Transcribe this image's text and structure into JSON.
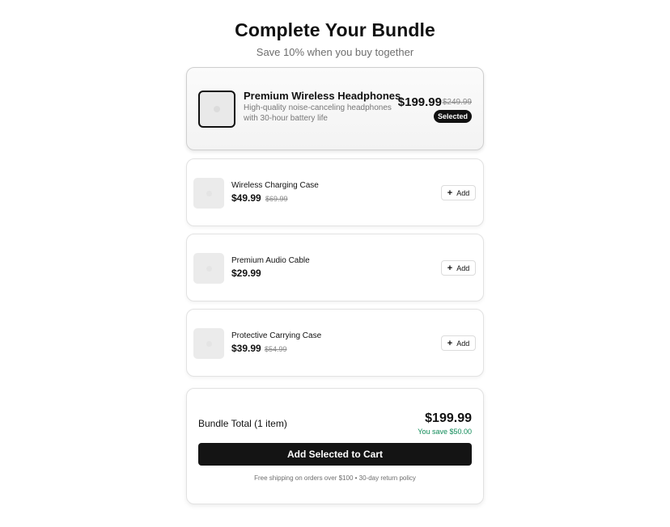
{
  "header": {
    "title": "Complete Your Bundle",
    "subtitle": "Save 10% when you buy together"
  },
  "main_product": {
    "name": "Premium Wireless Headphones",
    "description": "High-quality noise-canceling headphones with 30-hour battery life",
    "price": "$199.99",
    "original_price": "$249.99",
    "badge": "Selected",
    "selected": true
  },
  "accessories": [
    {
      "name": "Wireless Charging Case",
      "price": "$49.99",
      "original_price": "$69.99",
      "add_label": "Add"
    },
    {
      "name": "Premium Audio Cable",
      "price": "$29.99",
      "original_price": "",
      "add_label": "Add"
    },
    {
      "name": "Protective Carrying Case",
      "price": "$39.99",
      "original_price": "$54.99",
      "add_label": "Add"
    }
  ],
  "summary": {
    "total_label": "Bundle Total (1 item)",
    "total_price": "$199.99",
    "savings": "You save $50.00",
    "cta_label": "Add Selected to Cart",
    "policy": "Free shipping on orders over $100 • 30-day return policy"
  },
  "icons": {
    "add": "plus-icon",
    "thumbnail": "product-image-placeholder"
  },
  "colors": {
    "accent": "#111111",
    "savings": "#0e8a57",
    "muted_text": "#6e6e6e"
  }
}
